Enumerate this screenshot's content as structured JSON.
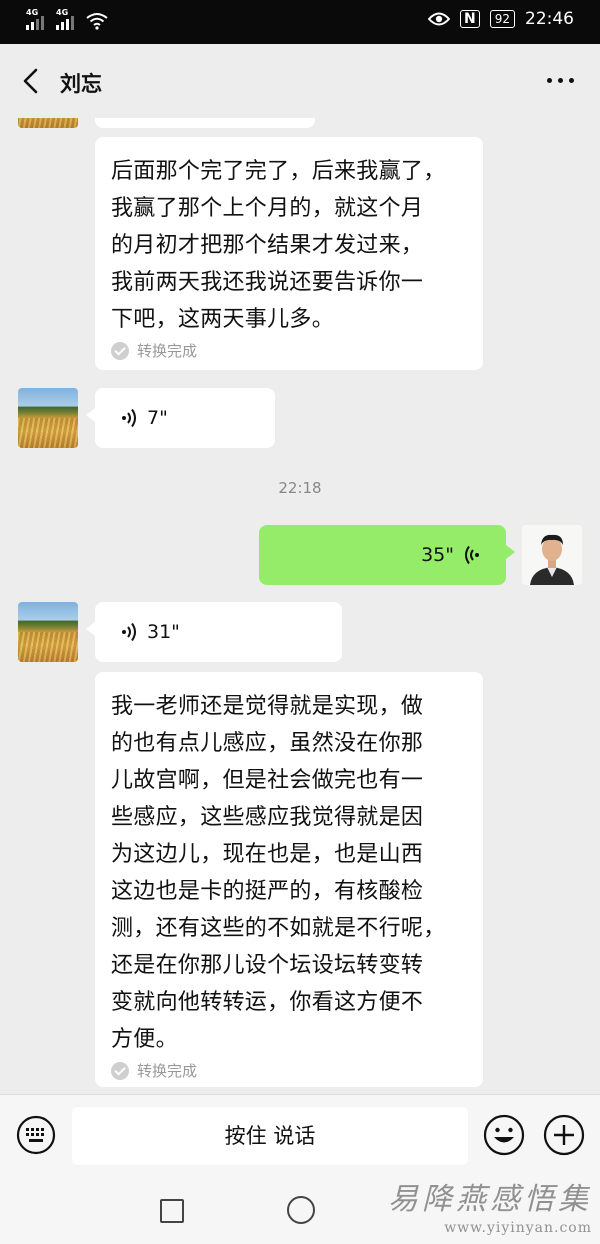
{
  "status_bar": {
    "sim1_label": "4G",
    "sim2_label": "4G",
    "battery": "92",
    "time": "22:46",
    "icons": [
      "signal-icon",
      "wifi-icon",
      "eye-icon",
      "nfc-icon",
      "battery-icon"
    ]
  },
  "header": {
    "contact_name": "刘忘",
    "back_icon": "back-arrow-icon",
    "more_icon": "more-icon"
  },
  "messages": {
    "transcript1": {
      "text": "后面那个完了完了，后来我赢了，\n我赢了那个上个月的，就这个月\n的月初才把那个结果才发过来，\n我前两天我还我说还要告诉你一\n下吧，这两天事儿多。",
      "status": "转换完成"
    },
    "voice1": {
      "duration": "7\""
    },
    "timestamp": "22:18",
    "voice_self": {
      "duration": "35\""
    },
    "voice2": {
      "duration": "31\""
    },
    "transcript2": {
      "text": "我一老师还是觉得就是实现，做\n的也有点儿感应，虽然没在你那\n儿故宫啊，但是社会做完也有一\n些感应，这些感应我觉得就是因\n为这边儿，现在也是，也是山西\n这边也是卡的挺严的，有核酸检\n测，还有这些的不如就是不行呢，\n还是在你那儿设个坛设坛转变转\n变就向他转转运，你看这方便不\n方便。",
      "status": "转换完成"
    }
  },
  "input_bar": {
    "hold_to_talk": "按住 说话",
    "icons": [
      "keyboard-icon",
      "emoji-icon",
      "plus-icon"
    ]
  },
  "watermark": {
    "chinese": "易降燕感悟集",
    "url": "www.yiyinyan.com"
  },
  "colors": {
    "self_bubble": "#95ec69",
    "other_bubble": "#ffffff",
    "chat_bg": "#ededed",
    "status_bar_bg": "#0a0a0a"
  }
}
